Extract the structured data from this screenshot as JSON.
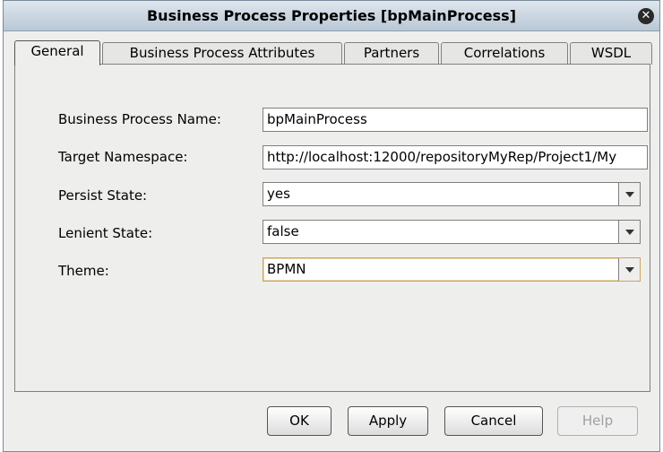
{
  "dialog": {
    "title": "Business Process Properties [bpMainProcess]"
  },
  "tabs": [
    {
      "label": "General",
      "active": true
    },
    {
      "label": "Business Process Attributes",
      "active": false
    },
    {
      "label": "Partners",
      "active": false
    },
    {
      "label": "Correlations",
      "active": false
    },
    {
      "label": "WSDL",
      "active": false
    }
  ],
  "form": {
    "name_label": "Business Process Name:",
    "name_value": "bpMainProcess",
    "namespace_label": "Target Namespace:",
    "namespace_value": "http://localhost:12000/repositoryMyRep/Project1/My",
    "persist_label": "Persist State:",
    "persist_value": "yes",
    "lenient_label": "Lenient State:",
    "lenient_value": "false",
    "theme_label": "Theme:",
    "theme_value": "BPMN"
  },
  "buttons": {
    "ok": "OK",
    "apply": "Apply",
    "cancel": "Cancel",
    "help": "Help"
  },
  "icons": {
    "close": "close-icon",
    "dropdown": "chevron-down-icon"
  },
  "colors": {
    "titlebar": "#b9c7d5",
    "dialog_bg": "#eeeeec",
    "focus_border": "#c8a464"
  }
}
